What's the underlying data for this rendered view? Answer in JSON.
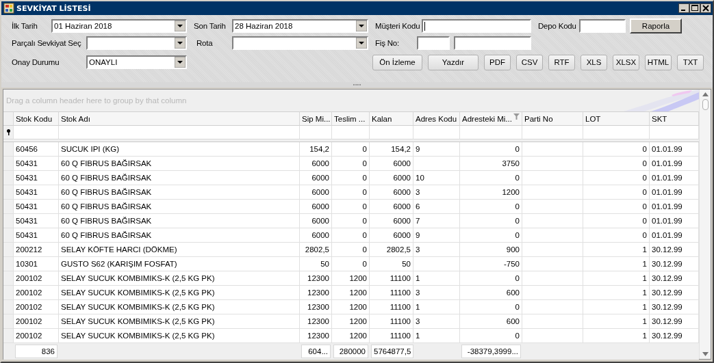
{
  "window": {
    "title": "SEVKİYAT LİSTESİ"
  },
  "filters": {
    "first_date": {
      "label": "İlk Tarih",
      "value": "01 Haziran 2018"
    },
    "last_date": {
      "label": "Son Tarih",
      "value": "28 Haziran 2018"
    },
    "customer_code": {
      "label": "Müşteri Kodu",
      "focused": true
    },
    "depot_code": {
      "label": "Depo Kodu"
    },
    "partial_shipment": {
      "label": "Parçalı Sevkiyat Seç"
    },
    "route": {
      "label": "Rota"
    },
    "receipt_no": {
      "label": "Fiş No:"
    },
    "approval_status": {
      "label": "Onay Durumu",
      "value": "ONAYLI"
    }
  },
  "report_button": "Raporla",
  "export_buttons": [
    "Ön İzleme",
    "Yazdır",
    "PDF",
    "CSV",
    "RTF",
    "XLS",
    "XLSX",
    "HTML",
    "TXT"
  ],
  "grid": {
    "group_panel_hint": "Drag a column header here to group by that column",
    "columns": [
      {
        "title": "Stok Kodu",
        "kind": "text",
        "filtered": false
      },
      {
        "title": "Stok Adı",
        "kind": "text",
        "filtered": false
      },
      {
        "title": "Sip Mi...",
        "kind": "number",
        "filtered": false
      },
      {
        "title": "Teslim ...",
        "kind": "number",
        "filtered": false
      },
      {
        "title": "Kalan",
        "kind": "number",
        "filtered": false
      },
      {
        "title": "Adres Kodu",
        "kind": "text",
        "filtered": false
      },
      {
        "title": "Adresteki Mi...",
        "kind": "number",
        "filtered": true
      },
      {
        "title": "Parti No",
        "kind": "text",
        "filtered": false
      },
      {
        "title": "LOT",
        "kind": "number",
        "filtered": false
      },
      {
        "title": "SKT",
        "kind": "text",
        "filtered": false
      }
    ],
    "rows": [
      [
        "60456",
        "SUCUK IPI (KG)",
        "154,2",
        "0",
        "154,2",
        "9",
        "0",
        null,
        "0",
        "01.01.99"
      ],
      [
        "50431",
        "60 Q FIBRUS BAĞIRSAK",
        "6000",
        "0",
        "6000",
        null,
        "3750",
        null,
        "0",
        "01.01.99"
      ],
      [
        "50431",
        "60 Q FIBRUS BAĞIRSAK",
        "6000",
        "0",
        "6000",
        "10",
        "0",
        null,
        "0",
        "01.01.99"
      ],
      [
        "50431",
        "60 Q FIBRUS BAĞIRSAK",
        "6000",
        "0",
        "6000",
        "3",
        "1200",
        null,
        "0",
        "01.01.99"
      ],
      [
        "50431",
        "60 Q FIBRUS BAĞIRSAK",
        "6000",
        "0",
        "6000",
        "6",
        "0",
        null,
        "0",
        "01.01.99"
      ],
      [
        "50431",
        "60 Q FIBRUS BAĞIRSAK",
        "6000",
        "0",
        "6000",
        "7",
        "0",
        null,
        "0",
        "01.01.99"
      ],
      [
        "50431",
        "60 Q FIBRUS BAĞIRSAK",
        "6000",
        "0",
        "6000",
        "9",
        "0",
        null,
        "0",
        "01.01.99"
      ],
      [
        "200212",
        "SELAY KÖFTE HARCI (DÖKME)",
        "2802,5",
        "0",
        "2802,5",
        "3",
        "900",
        null,
        "1",
        "30.12.99"
      ],
      [
        "10301",
        "GUSTO S62 (KARIŞIM FOSFAT)",
        "50",
        "0",
        "50",
        null,
        "-750",
        null,
        "1",
        "30.12.99"
      ],
      [
        "200102",
        "SELAY SUCUK KOMBIMIKS-K (2,5 KG PK)",
        "12300",
        "1200",
        "11100",
        "1",
        "0",
        null,
        "1",
        "30.12.99"
      ],
      [
        "200102",
        "SELAY SUCUK KOMBIMIKS-K (2,5 KG PK)",
        "12300",
        "1200",
        "11100",
        "3",
        "600",
        null,
        "1",
        "30.12.99"
      ],
      [
        "200102",
        "SELAY SUCUK KOMBIMIKS-K (2,5 KG PK)",
        "12300",
        "1200",
        "11100",
        "1",
        "0",
        null,
        "1",
        "30.12.99"
      ],
      [
        "200102",
        "SELAY SUCUK KOMBIMIKS-K (2,5 KG PK)",
        "12300",
        "1200",
        "11100",
        "3",
        "600",
        null,
        "1",
        "30.12.99"
      ],
      [
        "200102",
        "SELAY SUCUK KOMBIMIKS-K (2,5 KG PK)",
        "12300",
        "1200",
        "11100",
        "1",
        "0",
        null,
        "1",
        "30.12.99"
      ]
    ],
    "summary_row": {
      "column_1": "836",
      "column_3": "604...",
      "column_4": "280000",
      "column_5": "5764877,5",
      "column_7": "-38379,3999..."
    }
  }
}
